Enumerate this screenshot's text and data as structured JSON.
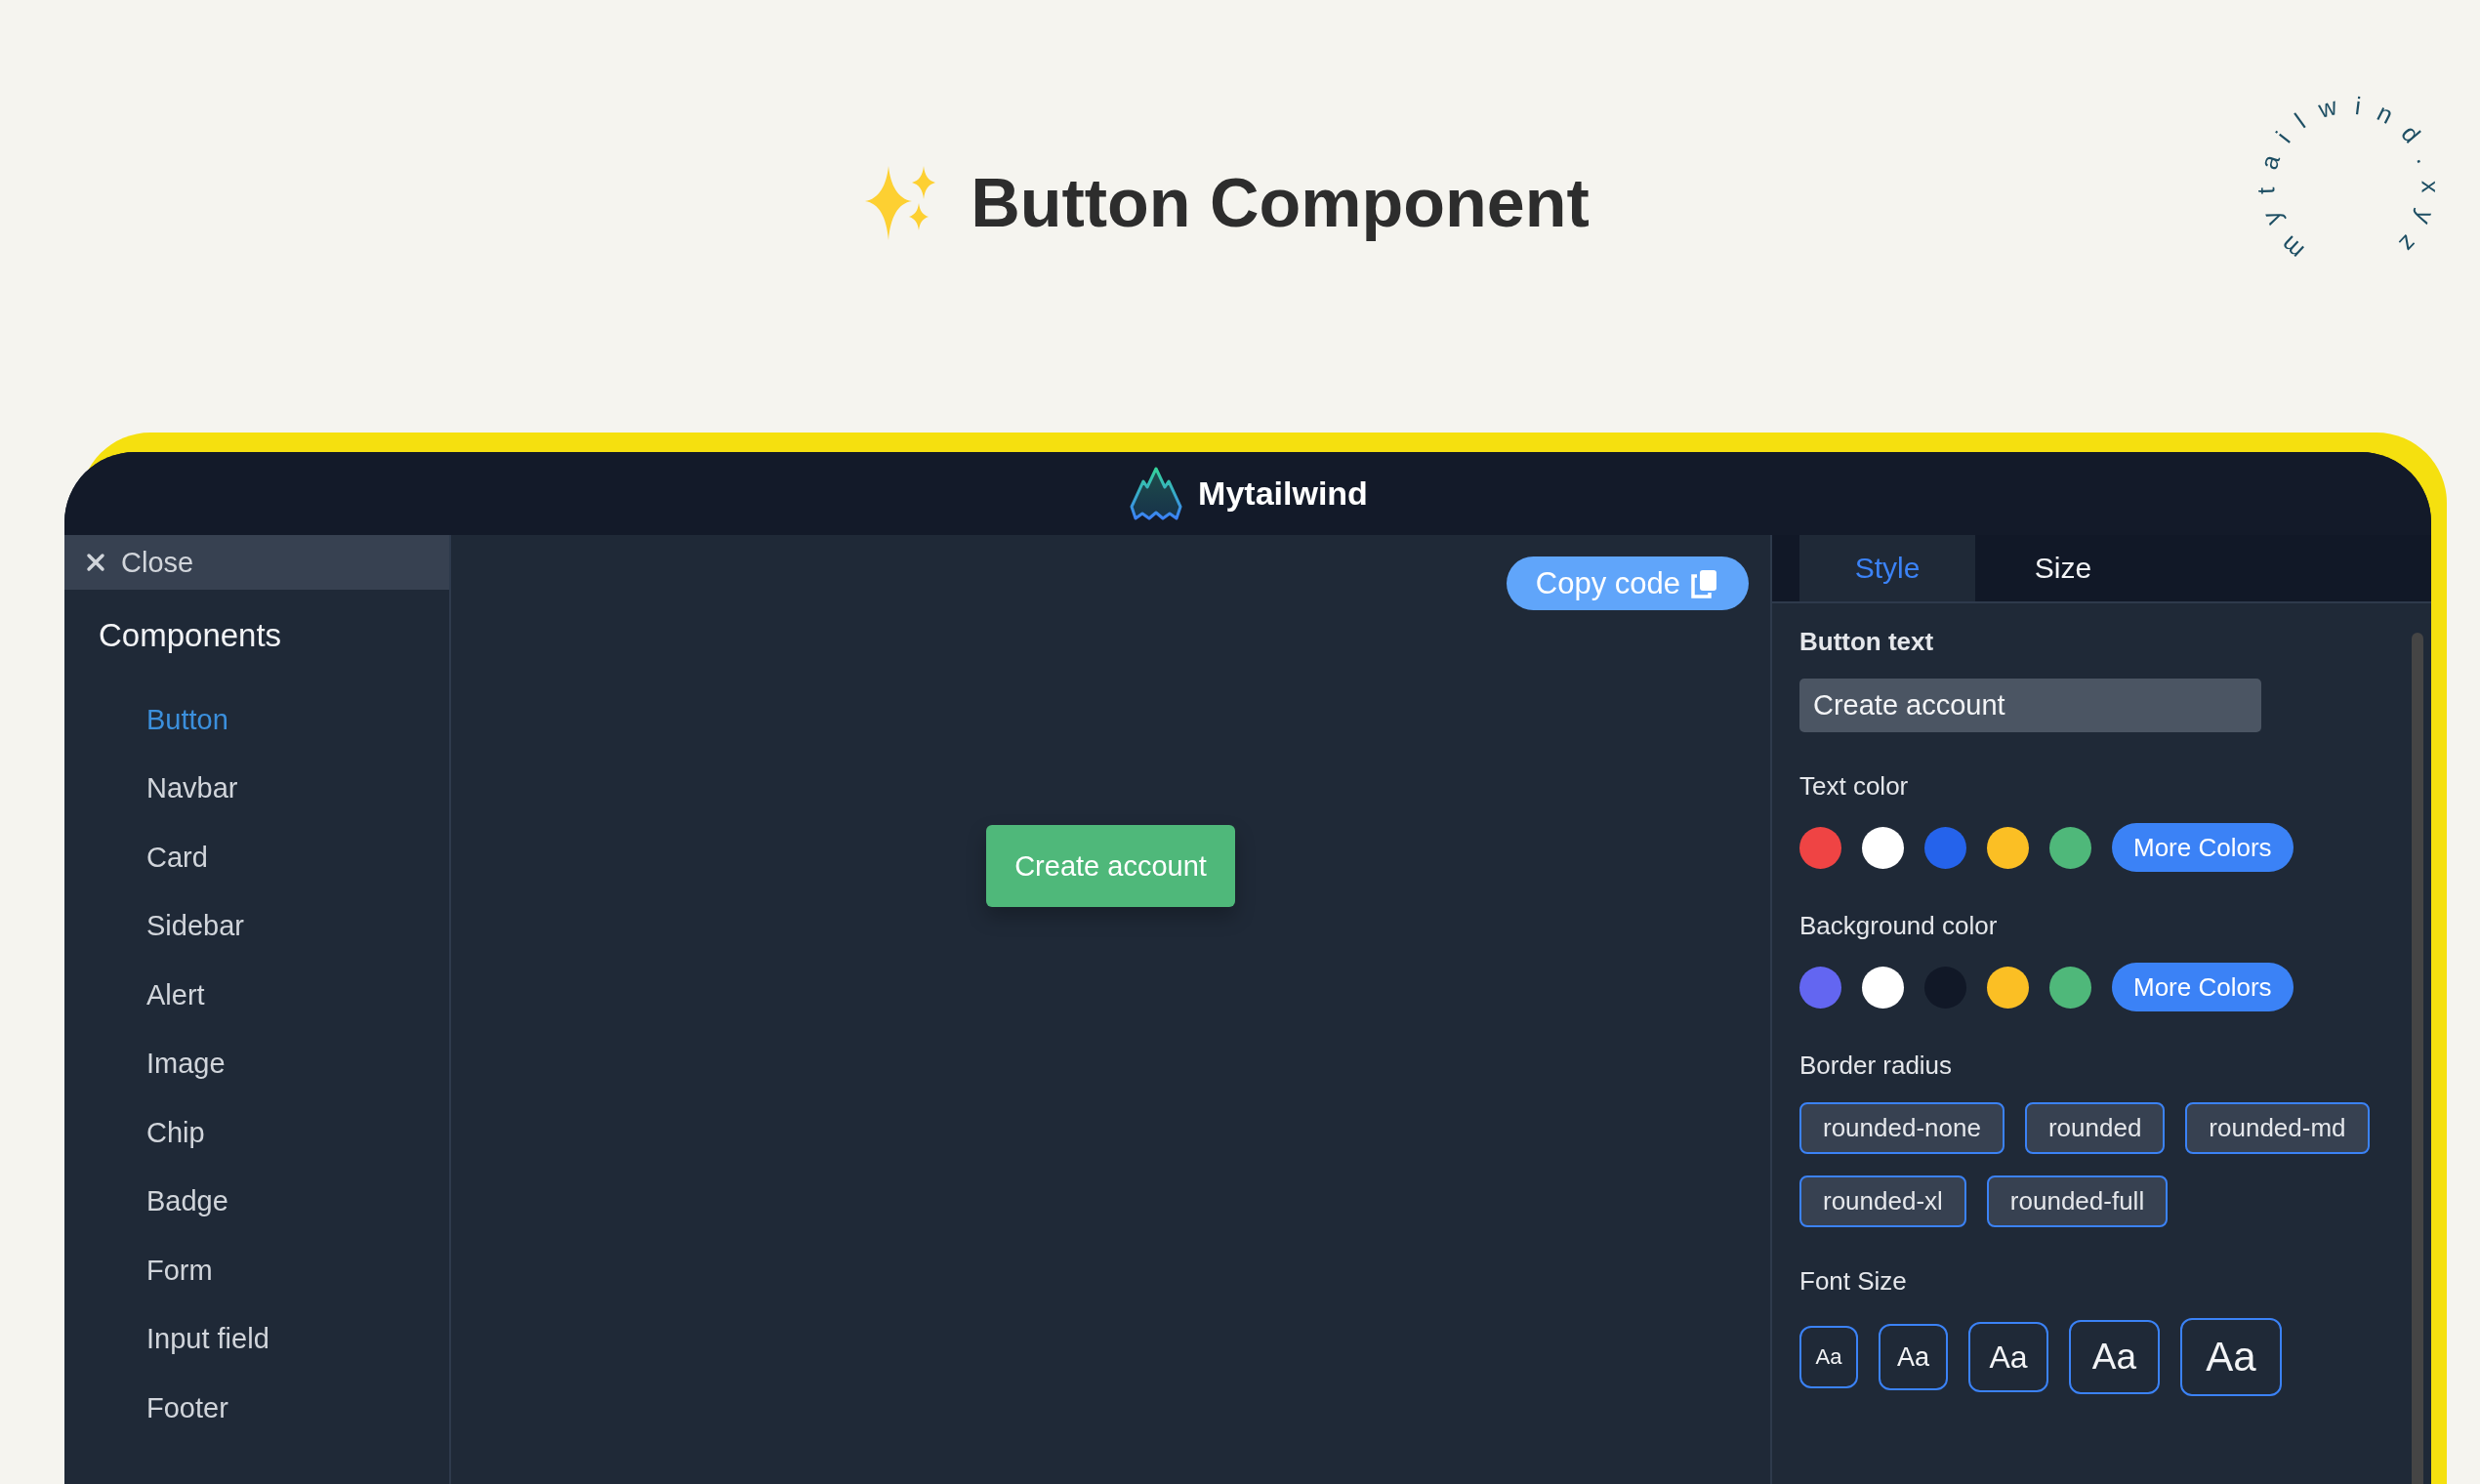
{
  "header": {
    "title": "Button Component",
    "badge": "mytailwind.xyz"
  },
  "navbar": {
    "brand": "Mytailwind"
  },
  "sidebar": {
    "close": "Close",
    "heading": "Components",
    "items": [
      {
        "label": "Button",
        "selected": true
      },
      {
        "label": "Navbar",
        "selected": false
      },
      {
        "label": "Card",
        "selected": false
      },
      {
        "label": "Sidebar",
        "selected": false
      },
      {
        "label": "Alert",
        "selected": false
      },
      {
        "label": "Image",
        "selected": false
      },
      {
        "label": "Chip",
        "selected": false
      },
      {
        "label": "Badge",
        "selected": false
      },
      {
        "label": "Form",
        "selected": false
      },
      {
        "label": "Input field",
        "selected": false
      },
      {
        "label": "Footer",
        "selected": false
      }
    ]
  },
  "preview": {
    "copy_button": "Copy code",
    "sample_button": "Create account"
  },
  "panel": {
    "tabs": [
      {
        "label": "Style",
        "selected": true
      },
      {
        "label": "Size",
        "selected": false
      }
    ],
    "sections": [
      {
        "kind": "text",
        "label": "Button text",
        "value": "Create account"
      },
      {
        "kind": "colors",
        "label": "Text color",
        "swatches": [
          {
            "color": "#ef4444"
          },
          {
            "color": "#ffffff"
          },
          {
            "color": "#2563eb"
          },
          {
            "color": "#fbbf24"
          },
          {
            "color": "#4fb87a"
          }
        ],
        "more": "More Colors"
      },
      {
        "kind": "colors",
        "label": "Background color",
        "swatches": [
          {
            "color": "#6366f1"
          },
          {
            "color": "#ffffff"
          },
          {
            "color": "#111827"
          },
          {
            "color": "#fbbf24"
          },
          {
            "color": "#4fb87a"
          }
        ],
        "more": "More Colors"
      },
      {
        "kind": "chips",
        "label": "Border radius",
        "options": [
          "rounded-none",
          "rounded",
          "rounded-md",
          "rounded-xl",
          "rounded-full"
        ]
      },
      {
        "kind": "font_sizes",
        "label": "Font Size",
        "options": [
          "Aa",
          "Aa",
          "Aa",
          "Aa",
          "Aa"
        ]
      }
    ]
  }
}
